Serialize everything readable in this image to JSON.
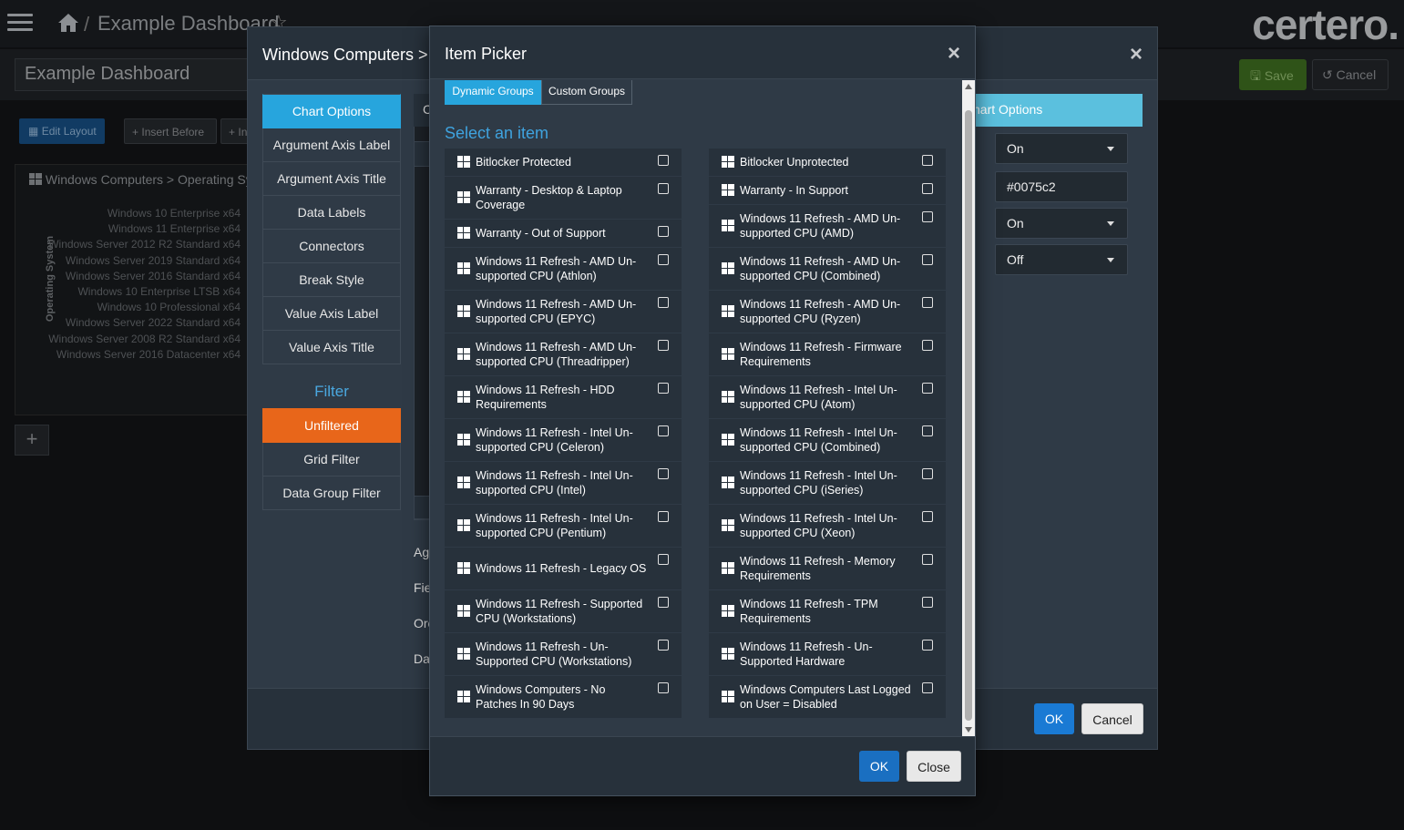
{
  "app": {
    "dashboard_title": "Example Dashboard",
    "crumb_separator": "/",
    "logo": "certero.",
    "dashboard_name_value": "Example Dashboard",
    "save_label": "Save",
    "cancel_label": "Cancel",
    "edit_layout_label": "Edit Layout",
    "insert_before_label": "Insert Before",
    "insert_after_label": "In",
    "add_widget_label": "+"
  },
  "widget": {
    "title": "Windows Computers > Operating Sy",
    "axis_title": "Operating System",
    "os_labels": [
      "Windows 10 Enterprise x64",
      "Windows 11 Enterprise x64",
      "Windows Server 2012 R2 Standard x64",
      "Windows Server 2019 Standard x64",
      "Windows Server 2016 Standard x64",
      "Windows 10 Enterprise LTSB x64",
      "Windows 10 Professional x64",
      "Windows Server 2022 Standard x64",
      "Windows Server 2008 R2 Standard x64",
      "Windows Server 2016 Datacenter x64"
    ]
  },
  "chart_modal": {
    "title": "Windows Computers > C",
    "close": "×",
    "menu": [
      "Chart Options",
      "Argument Axis Label",
      "Argument Axis Title",
      "Data Labels",
      "Connectors",
      "Break Style",
      "Value Axis Label",
      "Value Axis Title"
    ],
    "filter_heading": "Filter",
    "filter_menu": [
      "Unfiltered",
      "Grid Filter",
      "Data Group Filter"
    ],
    "center_tab": "C",
    "center_tab2": "C",
    "partial_labels": [
      "Ag",
      "Fie",
      "Orc",
      "Da"
    ],
    "right_tab": "hart Options",
    "right_controls": [
      "On",
      "#0075c2",
      "On",
      "Off"
    ],
    "ok": "OK",
    "cancel": "Cancel"
  },
  "picker": {
    "title": "Item Picker",
    "close": "×",
    "tabs": [
      "Dynamic Groups",
      "Custom Groups"
    ],
    "select_heading": "Select an item",
    "left_items": [
      "Bitlocker Protected",
      "Warranty - Desktop & Laptop Coverage",
      "Warranty - Out of Support",
      "Windows 11 Refresh - AMD Un-supported CPU (Athlon)",
      "Windows 11 Refresh - AMD Un-supported CPU (EPYC)",
      "Windows 11 Refresh - AMD Un-supported CPU (Threadripper)",
      "Windows 11 Refresh - HDD Requirements",
      "Windows 11 Refresh - Intel Un-supported CPU (Celeron)",
      "Windows 11 Refresh - Intel Un-supported CPU (Intel)",
      "Windows 11 Refresh - Intel Un-supported CPU (Pentium)",
      "Windows 11 Refresh - Legacy OS",
      "Windows 11 Refresh - Supported CPU (Workstations)",
      "Windows 11 Refresh - Un-Supported CPU (Workstations)",
      "Windows Computers - No Patches In 90 Days"
    ],
    "right_items": [
      "Bitlocker Unprotected",
      "Warranty - In Support",
      "Windows 11 Refresh - AMD Un-supported CPU (AMD)",
      "Windows 11 Refresh - AMD Un-supported CPU (Combined)",
      "Windows 11 Refresh - AMD Un-supported CPU (Ryzen)",
      "Windows 11 Refresh - Firmware Requirements",
      "Windows 11 Refresh - Intel Un-supported CPU (Atom)",
      "Windows 11 Refresh - Intel Un-supported CPU (Combined)",
      "Windows 11 Refresh - Intel Un-supported CPU (iSeries)",
      "Windows 11 Refresh - Intel Un-supported CPU (Xeon)",
      "Windows 11 Refresh - Memory Requirements",
      "Windows 11 Refresh - TPM Requirements",
      "Windows 11 Refresh - Un-Supported Hardware",
      "Windows Computers Last Logged on User = Disabled"
    ],
    "ok": "OK",
    "close_button": "Close"
  },
  "colors": {
    "accent_blue": "#27a5dd",
    "filter_orange": "#e8661a",
    "primary_button": "#1a7ad4",
    "link_blue": "#3fa3df"
  }
}
